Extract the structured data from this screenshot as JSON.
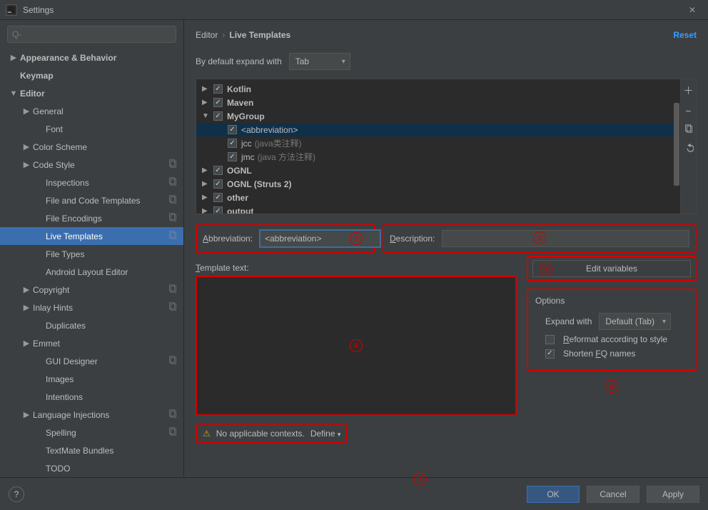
{
  "window": {
    "title": "Settings",
    "reset": "Reset"
  },
  "search": {
    "placeholder": "Q-"
  },
  "sidebar": {
    "items": [
      {
        "label": "Appearance & Behavior",
        "level": 0,
        "exp": "▶",
        "bold": true,
        "sch": false
      },
      {
        "label": "Keymap",
        "level": 0,
        "exp": "",
        "bold": true,
        "sch": false
      },
      {
        "label": "Editor",
        "level": 0,
        "exp": "▼",
        "bold": true,
        "sch": false
      },
      {
        "label": "General",
        "level": 1,
        "exp": "▶",
        "bold": false,
        "sch": false
      },
      {
        "label": "Font",
        "level": 2,
        "exp": "",
        "bold": false,
        "sch": false
      },
      {
        "label": "Color Scheme",
        "level": 1,
        "exp": "▶",
        "bold": false,
        "sch": false
      },
      {
        "label": "Code Style",
        "level": 1,
        "exp": "▶",
        "bold": false,
        "sch": true
      },
      {
        "label": "Inspections",
        "level": 2,
        "exp": "",
        "bold": false,
        "sch": true
      },
      {
        "label": "File and Code Templates",
        "level": 2,
        "exp": "",
        "bold": false,
        "sch": true
      },
      {
        "label": "File Encodings",
        "level": 2,
        "exp": "",
        "bold": false,
        "sch": true
      },
      {
        "label": "Live Templates",
        "level": 2,
        "exp": "",
        "bold": false,
        "sch": true,
        "selected": true
      },
      {
        "label": "File Types",
        "level": 2,
        "exp": "",
        "bold": false,
        "sch": false
      },
      {
        "label": "Android Layout Editor",
        "level": 2,
        "exp": "",
        "bold": false,
        "sch": false
      },
      {
        "label": "Copyright",
        "level": 1,
        "exp": "▶",
        "bold": false,
        "sch": true
      },
      {
        "label": "Inlay Hints",
        "level": 1,
        "exp": "▶",
        "bold": false,
        "sch": true
      },
      {
        "label": "Duplicates",
        "level": 2,
        "exp": "",
        "bold": false,
        "sch": false
      },
      {
        "label": "Emmet",
        "level": 1,
        "exp": "▶",
        "bold": false,
        "sch": false
      },
      {
        "label": "GUI Designer",
        "level": 2,
        "exp": "",
        "bold": false,
        "sch": true
      },
      {
        "label": "Images",
        "level": 2,
        "exp": "",
        "bold": false,
        "sch": false
      },
      {
        "label": "Intentions",
        "level": 2,
        "exp": "",
        "bold": false,
        "sch": false
      },
      {
        "label": "Language Injections",
        "level": 1,
        "exp": "▶",
        "bold": false,
        "sch": true
      },
      {
        "label": "Spelling",
        "level": 2,
        "exp": "",
        "bold": false,
        "sch": true
      },
      {
        "label": "TextMate Bundles",
        "level": 2,
        "exp": "",
        "bold": false,
        "sch": false
      },
      {
        "label": "TODO",
        "level": 2,
        "exp": "",
        "bold": false,
        "sch": false
      }
    ]
  },
  "breadcrumb": {
    "a": "Editor",
    "sep": "›",
    "b": "Live Templates"
  },
  "expandRow": {
    "label": "By default expand with",
    "value": "Tab"
  },
  "templates": {
    "rows": [
      {
        "exp": "▶",
        "chk": true,
        "label": "Kotlin",
        "bold": true,
        "pad": 0
      },
      {
        "exp": "▶",
        "chk": true,
        "label": "Maven",
        "bold": true,
        "pad": 0
      },
      {
        "exp": "▼",
        "chk": true,
        "label": "MyGroup",
        "bold": true,
        "pad": 0
      },
      {
        "exp": "",
        "chk": true,
        "label": "<abbreviation>",
        "bold": false,
        "pad": 1,
        "sel": true
      },
      {
        "exp": "",
        "chk": true,
        "label": "jcc",
        "hint": "(java类注释)",
        "bold": false,
        "pad": 1
      },
      {
        "exp": "",
        "chk": true,
        "label": "jmc",
        "hint": "(java 方法注释)",
        "bold": false,
        "pad": 1
      },
      {
        "exp": "▶",
        "chk": true,
        "label": "OGNL",
        "bold": true,
        "pad": 0
      },
      {
        "exp": "▶",
        "chk": true,
        "label": "OGNL (Struts 2)",
        "bold": true,
        "pad": 0
      },
      {
        "exp": "▶",
        "chk": true,
        "label": "other",
        "bold": true,
        "pad": 0
      },
      {
        "exp": "▶",
        "chk": true,
        "label": "output",
        "bold": true,
        "pad": 0
      }
    ]
  },
  "form": {
    "abbr_label": "Abbreviation:",
    "abbr_value": "<abbreviation>",
    "desc_label": "Description:",
    "desc_value": "",
    "tmpl_label": "Template text:",
    "editvars": "Edit variables",
    "options_hdr": "Options",
    "expand_label": "Expand with",
    "expand_value": "Default (Tab)",
    "opt_reformat": "Reformat according to style",
    "opt_shorten": "Shorten FQ names",
    "context_warn": "No applicable contexts.",
    "context_define": "Define"
  },
  "markers": {
    "m1": "①",
    "m2": "②",
    "m3": "③",
    "m4": "④",
    "m5": "⑤",
    "m6": "⑥"
  },
  "footer": {
    "ok": "OK",
    "cancel": "Cancel",
    "apply": "Apply"
  }
}
